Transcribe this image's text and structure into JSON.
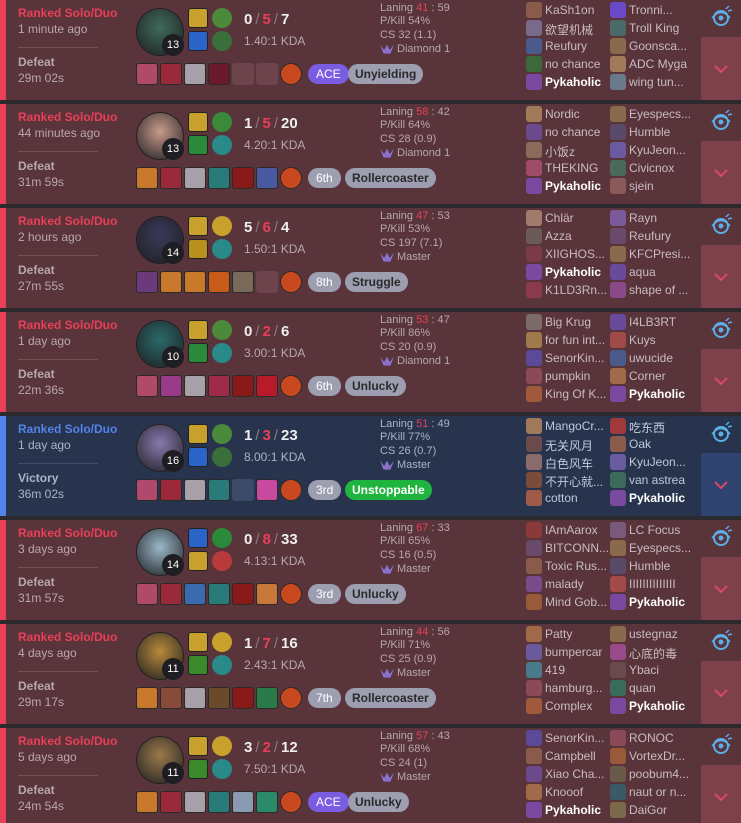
{
  "matches": [
    {
      "result_type": "loss",
      "queue": "Ranked Solo/Duo",
      "time_ago": "1 minute ago",
      "result": "Defeat",
      "duration": "29m 02s",
      "champion_color": "#3f6b5a",
      "level": "13",
      "kills": "0",
      "deaths": "5",
      "assists": "7",
      "kda_ratio": "1.40:1 KDA",
      "spell_colors": [
        "#c8a02c",
        "#2a64c8"
      ],
      "rune_colors": [
        "#4a8a3a",
        "#3a6e3a"
      ],
      "items": [
        "#b04a6a",
        "#9a2a3a",
        "#a8a0a8",
        "#6a1a2a",
        "",
        ""
      ],
      "placement": "ACE",
      "placement_type": "ace",
      "badge": "Unyielding",
      "badge_type": "normal",
      "laning_win": "41",
      "laning_loss": "59",
      "pkill": "P/Kill 54%",
      "cs": "CS 32 (1.1)",
      "rank": "Diamond 1",
      "team1": [
        {
          "name": "KaSh1on",
          "color": "#8a5a4a"
        },
        {
          "name": "欲望机械",
          "color": "#7a6a8a"
        },
        {
          "name": "Reufury",
          "color": "#4a5a8a"
        },
        {
          "name": "no chance",
          "color": "#3a6a3a"
        },
        {
          "name": "Pykaholic",
          "color": "#7a4aa0",
          "me": true
        }
      ],
      "team2": [
        {
          "name": "Tronni...",
          "color": "#6a4ac8"
        },
        {
          "name": "Troll King",
          "color": "#4a6a6a"
        },
        {
          "name": "Goonsca...",
          "color": "#8a6a4a"
        },
        {
          "name": "ADC Myga",
          "color": "#a07a5a"
        },
        {
          "name": "wing tun...",
          "color": "#6a7a8a"
        }
      ]
    },
    {
      "result_type": "loss",
      "queue": "Ranked Solo/Duo",
      "time_ago": "44 minutes ago",
      "result": "Defeat",
      "duration": "31m 59s",
      "champion_color": "#c89a8a",
      "level": "13",
      "kills": "1",
      "deaths": "5",
      "assists": "20",
      "kda_ratio": "4.20:1 KDA",
      "spell_colors": [
        "#c8a02c",
        "#2a8a3a"
      ],
      "rune_colors": [
        "#3a8a3a",
        "#2a8a8a"
      ],
      "items": [
        "#c8782a",
        "#9a2a3a",
        "#a8a0a8",
        "#2a7a7a",
        "#8a1a1a",
        "#4a5aa0"
      ],
      "placement": "6th",
      "placement_type": "normal",
      "badge": "Rollercoaster",
      "badge_type": "normal",
      "laning_win": "58",
      "laning_loss": "42",
      "pkill": "P/Kill 64%",
      "cs": "CS 28 (0.9)",
      "rank": "Diamond 1",
      "team1": [
        {
          "name": "Nordic",
          "color": "#a07a5a"
        },
        {
          "name": "no chance",
          "color": "#6a4a8a"
        },
        {
          "name": "小饭z",
          "color": "#8a6a5a"
        },
        {
          "name": "THEKING",
          "color": "#a04a6a"
        },
        {
          "name": "Pykaholic",
          "color": "#7a4aa0",
          "me": true
        }
      ],
      "team2": [
        {
          "name": "Eyespecs...",
          "color": "#8a6a4a"
        },
        {
          "name": "Humble",
          "color": "#5a4a6a"
        },
        {
          "name": "KyuJeon...",
          "color": "#6a5aa0"
        },
        {
          "name": "Civicnox",
          "color": "#4a6a5a"
        },
        {
          "name": "sjein",
          "color": "#8a5a5a"
        }
      ]
    },
    {
      "result_type": "loss",
      "queue": "Ranked Solo/Duo",
      "time_ago": "2 hours ago",
      "result": "Defeat",
      "duration": "27m 55s",
      "champion_color": "#3a3a5a",
      "level": "14",
      "kills": "5",
      "deaths": "6",
      "assists": "4",
      "kda_ratio": "1.50:1 KDA",
      "spell_colors": [
        "#c8a02c",
        "#b8901c"
      ],
      "rune_colors": [
        "#c8a02c",
        "#2a8a8a"
      ],
      "items": [
        "#6a3a7a",
        "#c8782a",
        "#c87a2a",
        "#c85a1a",
        "#7a6a5a",
        ""
      ],
      "placement": "8th",
      "placement_type": "normal",
      "badge": "Struggle",
      "badge_type": "normal",
      "laning_win": "47",
      "laning_loss": "53",
      "pkill": "P/Kill 53%",
      "cs": "CS 197 (7.1)",
      "rank": "Master",
      "team1": [
        {
          "name": "Chlär",
          "color": "#a07a6a"
        },
        {
          "name": "Azza",
          "color": "#6a5a5a"
        },
        {
          "name": "XIIGHOS...",
          "color": "#7a3a4a"
        },
        {
          "name": "Pykaholic",
          "color": "#7a4aa0",
          "me": true
        },
        {
          "name": "K1LD3Rn...",
          "color": "#8a3a4a"
        }
      ],
      "team2": [
        {
          "name": "Rayn",
          "color": "#7a5a9a"
        },
        {
          "name": "Reufury",
          "color": "#6a4a6a"
        },
        {
          "name": "KFCPresi...",
          "color": "#8a6a4a"
        },
        {
          "name": "aqua",
          "color": "#6a4a9a"
        },
        {
          "name": "shape of ...",
          "color": "#8a4a8a"
        }
      ]
    },
    {
      "result_type": "loss",
      "queue": "Ranked Solo/Duo",
      "time_ago": "1 day ago",
      "result": "Defeat",
      "duration": "22m 36s",
      "champion_color": "#2a6a6a",
      "level": "10",
      "kills": "0",
      "deaths": "2",
      "assists": "6",
      "kda_ratio": "3.00:1 KDA",
      "spell_colors": [
        "#c8a02c",
        "#2a8a3a"
      ],
      "rune_colors": [
        "#4a8a3a",
        "#2a8a8a"
      ],
      "items": [
        "#b04a6a",
        "#9a3a8a",
        "#a8a0a8",
        "#a02a4a",
        "#8a1a1a",
        "#b81a2a"
      ],
      "placement": "6th",
      "placement_type": "normal",
      "badge": "Unlucky",
      "badge_type": "normal",
      "laning_win": "53",
      "laning_loss": "47",
      "pkill": "P/Kill 86%",
      "cs": "CS 20 (0.9)",
      "rank": "Diamond 1",
      "team1": [
        {
          "name": "Big Krug",
          "color": "#7a6a6a"
        },
        {
          "name": "for fun int...",
          "color": "#a07a4a"
        },
        {
          "name": "SenorKin...",
          "color": "#5a4a9a"
        },
        {
          "name": "pumpkin",
          "color": "#8a4a5a"
        },
        {
          "name": "King Of K...",
          "color": "#a05a3a"
        }
      ],
      "team2": [
        {
          "name": "I4LB3RT",
          "color": "#6a4a9a"
        },
        {
          "name": "Kuys",
          "color": "#a04a4a"
        },
        {
          "name": "uwucide",
          "color": "#4a5a8a"
        },
        {
          "name": "Corner",
          "color": "#a06a4a"
        },
        {
          "name": "Pykaholic",
          "color": "#7a4aa0",
          "me": true
        }
      ]
    },
    {
      "result_type": "win",
      "queue": "Ranked Solo/Duo",
      "time_ago": "1 day ago",
      "result": "Victory",
      "duration": "36m 02s",
      "champion_color": "#8a7ab0",
      "level": "16",
      "kills": "1",
      "deaths": "3",
      "assists": "23",
      "kda_ratio": "8.00:1 KDA",
      "spell_colors": [
        "#c8a02c",
        "#2a64c8"
      ],
      "rune_colors": [
        "#4a8a3a",
        "#3a6e3a"
      ],
      "items": [
        "#b04a6a",
        "#9a2a3a",
        "#a8a0a8",
        "#2a7a7a",
        "",
        "#c84aa0"
      ],
      "placement": "3rd",
      "placement_type": "normal",
      "badge": "Unstoppable",
      "badge_type": "unstop",
      "laning_win": "51",
      "laning_loss": "49",
      "pkill": "P/Kill 77%",
      "cs": "CS 26 (0.7)",
      "rank": "Master",
      "team1": [
        {
          "name": "MangoCr...",
          "color": "#a07a5a"
        },
        {
          "name": "无关风月",
          "color": "#6a4a4a"
        },
        {
          "name": "白色风车",
          "color": "#8a6a6a"
        },
        {
          "name": "不开心就...",
          "color": "#7a4a3a"
        },
        {
          "name": "cotton",
          "color": "#a05a4a"
        }
      ],
      "team2": [
        {
          "name": "吃东西",
          "color": "#a03a3a"
        },
        {
          "name": "Oak",
          "color": "#8a5a4a"
        },
        {
          "name": "KyuJeon...",
          "color": "#6a5aa0"
        },
        {
          "name": "van astrea",
          "color": "#3a6a5a"
        },
        {
          "name": "Pykaholic",
          "color": "#7a4aa0",
          "me": true
        }
      ]
    },
    {
      "result_type": "loss",
      "queue": "Ranked Solo/Duo",
      "time_ago": "3 days ago",
      "result": "Defeat",
      "duration": "31m 57s",
      "champion_color": "#9ab8c8",
      "level": "14",
      "kills": "0",
      "deaths": "8",
      "assists": "33",
      "kda_ratio": "4.13:1 KDA",
      "spell_colors": [
        "#2a64c8",
        "#c8a02c"
      ],
      "rune_colors": [
        "#2a8a3a",
        "#b83a3a"
      ],
      "items": [
        "#b04a6a",
        "#9a2a3a",
        "#3a6ab0",
        "#2a7a7a",
        "#8a1a1a",
        "#c8783a"
      ],
      "placement": "3rd",
      "placement_type": "normal",
      "badge": "Unlucky",
      "badge_type": "normal",
      "laning_win": "67",
      "laning_loss": "33",
      "pkill": "P/Kill 65%",
      "cs": "CS 16 (0.5)",
      "rank": "Master",
      "team1": [
        {
          "name": "IAmAarox",
          "color": "#8a3a3a"
        },
        {
          "name": "BITCONN...",
          "color": "#6a4a6a"
        },
        {
          "name": "Toxic Rus...",
          "color": "#8a5a4a"
        },
        {
          "name": "malady",
          "color": "#7a4a8a"
        },
        {
          "name": "Mind Gob...",
          "color": "#9a5a3a"
        }
      ],
      "team2": [
        {
          "name": "LC Focus",
          "color": "#7a5a7a"
        },
        {
          "name": "Eyespecs...",
          "color": "#8a6a4a"
        },
        {
          "name": "Humble",
          "color": "#5a4a6a"
        },
        {
          "name": "IIIIIIIIIIIIII",
          "color": "#a04a4a"
        },
        {
          "name": "Pykaholic",
          "color": "#7a4aa0",
          "me": true
        }
      ]
    },
    {
      "result_type": "loss",
      "queue": "Ranked Solo/Duo",
      "time_ago": "4 days ago",
      "result": "Defeat",
      "duration": "29m 17s",
      "champion_color": "#b88a3a",
      "level": "11",
      "kills": "1",
      "deaths": "7",
      "assists": "16",
      "kda_ratio": "2.43:1 KDA",
      "spell_colors": [
        "#c8a02c",
        "#3a8a2a"
      ],
      "rune_colors": [
        "#c8a02c",
        "#2a8a8a"
      ],
      "items": [
        "#c8782a",
        "#8a4a3a",
        "#a8a0a8",
        "#6a4a2a",
        "#8a1a1a",
        "#2a7a4a"
      ],
      "placement": "7th",
      "placement_type": "normal",
      "badge": "Rollercoaster",
      "badge_type": "normal",
      "laning_win": "44",
      "laning_loss": "56",
      "pkill": "P/Kill 71%",
      "cs": "CS 25 (0.9)",
      "rank": "Master",
      "team1": [
        {
          "name": "Patty",
          "color": "#a06a4a"
        },
        {
          "name": "bumpercar",
          "color": "#6a5a9a"
        },
        {
          "name": "419",
          "color": "#4a7a8a"
        },
        {
          "name": "hamburg...",
          "color": "#8a4a5a"
        },
        {
          "name": "Complex",
          "color": "#a05a3a"
        }
      ],
      "team2": [
        {
          "name": "ustegnaz",
          "color": "#8a6a4a"
        },
        {
          "name": "心底的毒",
          "color": "#9a4a8a"
        },
        {
          "name": "Ybaci",
          "color": "#6a4a4a"
        },
        {
          "name": "quan",
          "color": "#3a6a5a"
        },
        {
          "name": "Pykaholic",
          "color": "#7a4aa0",
          "me": true
        }
      ]
    },
    {
      "result_type": "loss",
      "queue": "Ranked Solo/Duo",
      "time_ago": "5 days ago",
      "result": "Defeat",
      "duration": "24m 54s",
      "champion_color": "#9a7a4a",
      "level": "11",
      "kills": "3",
      "deaths": "2",
      "assists": "12",
      "kda_ratio": "7.50:1 KDA",
      "spell_colors": [
        "#c8a02c",
        "#3a8a2a"
      ],
      "rune_colors": [
        "#c8a02c",
        "#2a8a8a"
      ],
      "items": [
        "#c8782a",
        "#9a2a3a",
        "#a8a0a8",
        "#2a7a7a",
        "#8a9ab0",
        "#2a8a6a"
      ],
      "placement": "ACE",
      "placement_type": "ace",
      "badge": "Unlucky",
      "badge_type": "normal",
      "laning_win": "57",
      "laning_loss": "43",
      "pkill": "P/Kill 68%",
      "cs": "CS 24 (1)",
      "rank": "Master",
      "team1": [
        {
          "name": "SenorKin...",
          "color": "#5a4a9a"
        },
        {
          "name": "Campbell",
          "color": "#8a5a4a"
        },
        {
          "name": "Xiao Cha...",
          "color": "#6a4a8a"
        },
        {
          "name": "Knooof",
          "color": "#a06a4a"
        },
        {
          "name": "Pykaholic",
          "color": "#7a4aa0",
          "me": true
        }
      ],
      "team2": [
        {
          "name": "RONOC",
          "color": "#8a4a5a"
        },
        {
          "name": "VortexDr...",
          "color": "#9a5a3a"
        },
        {
          "name": "poobum4...",
          "color": "#6a5a4a"
        },
        {
          "name": "naut or n...",
          "color": "#3a5a6a"
        },
        {
          "name": "DaiGor",
          "color": "#7a6a4a"
        }
      ]
    }
  ]
}
